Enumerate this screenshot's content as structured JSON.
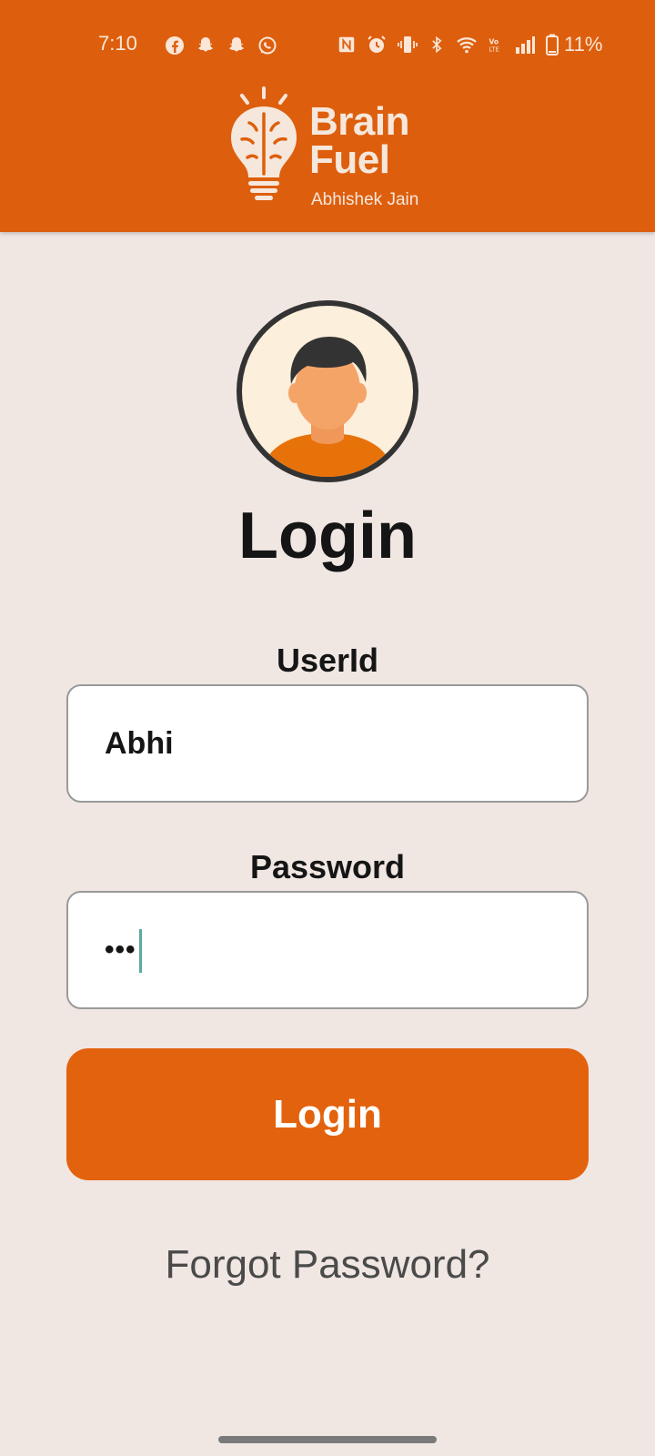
{
  "status_bar": {
    "time": "7:10",
    "battery_percent": "11%",
    "app_icons": [
      "facebook-icon",
      "snapchat-icon",
      "snapchat-icon",
      "whatsapp-icon"
    ],
    "system_icons": [
      "nfc-icon",
      "alarm-icon",
      "vibrate-icon",
      "bluetooth-icon",
      "wifi-icon",
      "volte-icon",
      "signal-icon",
      "battery-icon"
    ]
  },
  "header": {
    "logo_title_line1": "Brain",
    "logo_title_line2": "Fuel",
    "logo_subtitle": "Abhishek Jain",
    "background_color": "#dd5f0d"
  },
  "login": {
    "title": "Login",
    "userid_label": "UserId",
    "userid_value": "Abhi",
    "password_label": "Password",
    "password_masked": "•••",
    "button_label": "Login",
    "forgot_password": "Forgot Password?",
    "button_color": "#e3620d"
  }
}
